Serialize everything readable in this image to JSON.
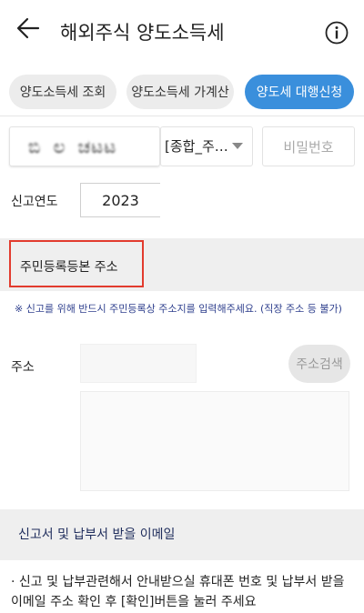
{
  "header": {
    "title": "해외주식 양도소득세",
    "back_icon": "arrow-left-icon",
    "info_icon": "info-circle-icon"
  },
  "tabs": [
    {
      "label": "양도소득세 조회",
      "active": false
    },
    {
      "label": "양도소득세 가계산",
      "active": false
    },
    {
      "label": "양도세 대행신청",
      "active": true
    }
  ],
  "account": {
    "masked_number": "ಬಿ ಲ ಚಟಟ",
    "type_label": "[종합_주…",
    "password_placeholder": "비밀번호"
  },
  "report_year": {
    "label": "신고연도",
    "value": "2023"
  },
  "address_section": {
    "title": "주민등록등본 주소",
    "notice": "※ 신고를 위해 반드시 주민등록상 주소지를 입력해주세요. (직장 주소 등 불가)",
    "label": "주소",
    "search_button": "주소검색"
  },
  "email_section": {
    "title": "신고서 및 납부서 받을 이메일",
    "description": "· 신고 및 납부관련해서 안내받으실 휴대폰 번호 및 납부서 받을 이메일 주소 확인 후 [확인]버튼을 눌러 주세요"
  },
  "colors": {
    "accent": "#3a8fdc",
    "highlight_border": "#e23b2e",
    "notice_text": "#2e3f8d"
  }
}
